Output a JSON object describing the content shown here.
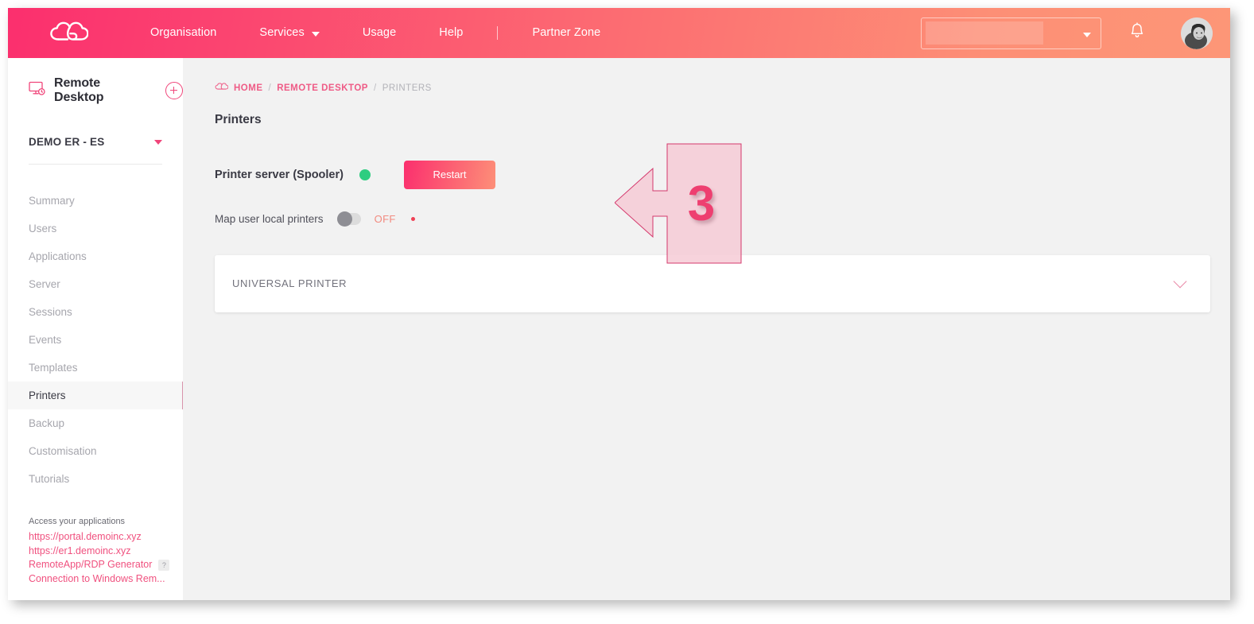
{
  "topbar": {
    "logo_icon": "cloud-logo-icon",
    "nav": [
      {
        "label": "Organisation",
        "caret": false
      },
      {
        "label": "Services",
        "caret": true
      },
      {
        "label": "Usage",
        "caret": false
      },
      {
        "label": "Help",
        "caret": false
      },
      {
        "label": "Partner Zone",
        "caret": false
      }
    ],
    "account_select_value": "",
    "bell_icon": "notification-bell-icon",
    "avatar_icon": "user-avatar"
  },
  "sidebar": {
    "service_icon": "remote-desktop-monitor-icon",
    "service_title": "Remote Desktop",
    "add_button_icon": "plus-circle-icon",
    "organisation": "DEMO ER - ES",
    "organisation_caret_icon": "caret-down-icon",
    "items": [
      {
        "label": "Summary",
        "active": false
      },
      {
        "label": "Users",
        "active": false
      },
      {
        "label": "Applications",
        "active": false
      },
      {
        "label": "Server",
        "active": false
      },
      {
        "label": "Sessions",
        "active": false
      },
      {
        "label": "Events",
        "active": false
      },
      {
        "label": "Templates",
        "active": false
      },
      {
        "label": "Printers",
        "active": true
      },
      {
        "label": "Backup",
        "active": false
      },
      {
        "label": "Customisation",
        "active": false
      },
      {
        "label": "Tutorials",
        "active": false
      }
    ],
    "footer": {
      "label": "Access your applications",
      "links": [
        {
          "text": "https://portal.demoinc.xyz",
          "help": false
        },
        {
          "text": "https://er1.demoinc.xyz",
          "help": false
        },
        {
          "text": "RemoteApp/RDP Generator",
          "help": true,
          "help_label": "?"
        },
        {
          "text": "Connection to Windows Rem...",
          "help": false
        }
      ]
    }
  },
  "main": {
    "breadcrumb": {
      "icon": "cloud-icon",
      "items": [
        "HOME",
        "REMOTE DESKTOP",
        "PRINTERS"
      ],
      "separator": "/"
    },
    "page_title": "Printers",
    "spooler": {
      "label": "Printer server (Spooler)",
      "status_color": "#2ecd80",
      "restart_label": "Restart"
    },
    "map_printers": {
      "label": "Map user local printers",
      "state": "OFF",
      "toggle_on": false
    },
    "printer_card": {
      "title": "UNIVERSAL PRINTER",
      "expand_icon": "chevron-down-icon"
    }
  },
  "annotation": {
    "step_number": "3",
    "fill_color": "#f6cbd6",
    "stroke_color": "#d4386c"
  }
}
